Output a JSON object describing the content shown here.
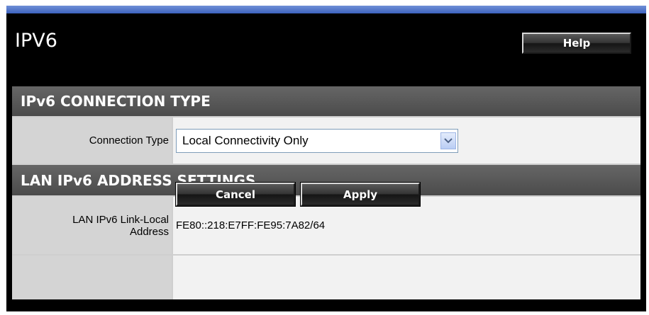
{
  "page": {
    "title": "IPV6"
  },
  "header": {
    "help_label": "Help"
  },
  "sections": {
    "connection_type": {
      "title": "IPv6 CONNECTION TYPE"
    },
    "lan_settings": {
      "title": "LAN IPv6 ADDRESS SETTINGS"
    }
  },
  "connection_type": {
    "label": "Connection Type",
    "selected": "Local Connectivity Only"
  },
  "lan": {
    "link_local_label_line1": "LAN IPv6 Link-Local",
    "link_local_label_line2": "Address",
    "link_local_value": "FE80::218:E7FF:FE95:7A82/64"
  },
  "actions": {
    "cancel_label": "Cancel",
    "apply_label": "Apply"
  },
  "colors": {
    "accent_bar": "#4a6fcc",
    "section_header": "#595959",
    "background": "#000000"
  },
  "icons": {
    "select_arrow": "chevron-down-icon"
  }
}
